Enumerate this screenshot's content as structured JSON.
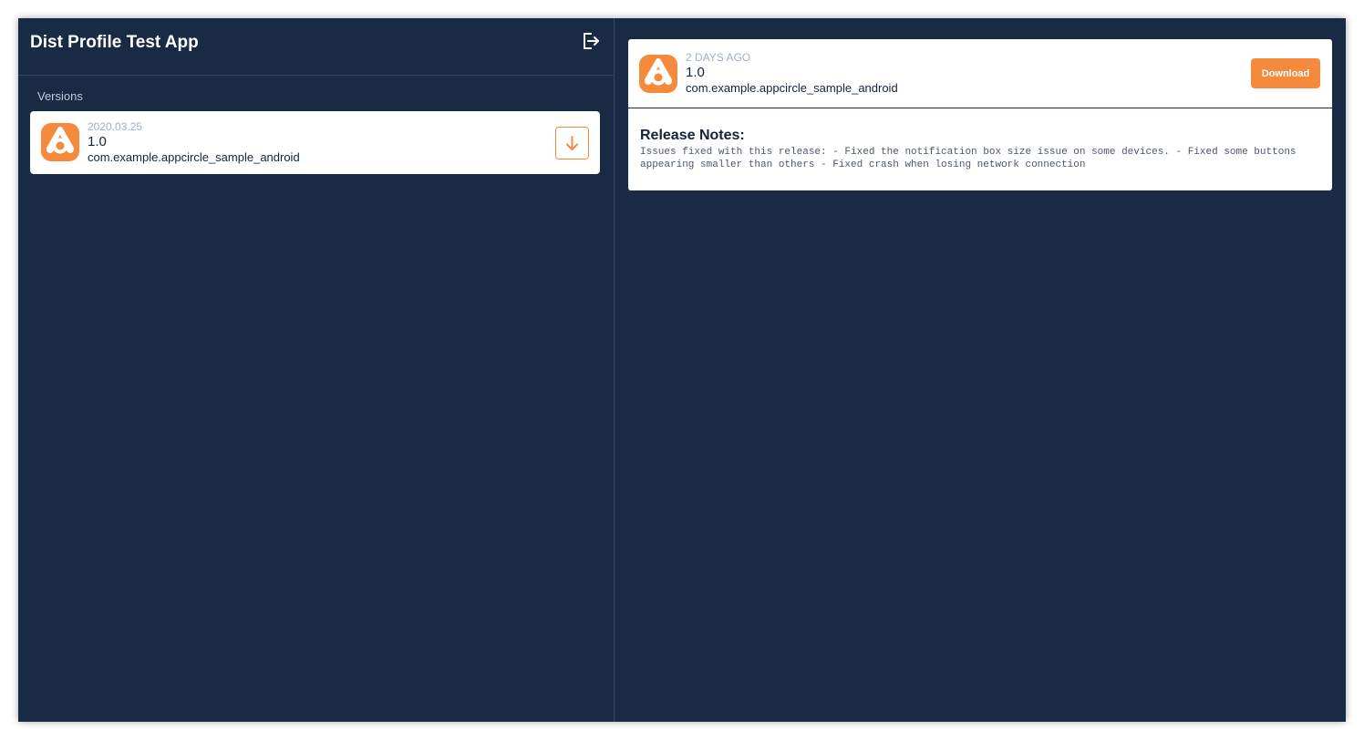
{
  "app": {
    "title": "Dist Profile Test App"
  },
  "header": {
    "logout_icon": "logout-icon"
  },
  "versions": {
    "label": "Versions",
    "items": [
      {
        "date": "2020.03.25",
        "version": "1.0",
        "package": "com.example.appcircle_sample_android",
        "icon": "appcircle-logo",
        "action_icon": "download-arrow-icon"
      }
    ]
  },
  "detail": {
    "time_ago": "2 DAYS AGO",
    "version": "1.0",
    "package": "com.example.appcircle_sample_android",
    "download_label": "Download",
    "release_notes_title": "Release Notes:",
    "release_notes": "Issues fixed with this release: - Fixed the notification box size issue on some devices. - Fixed some buttons appearing smaller than others - Fixed crash when losing network connection"
  },
  "colors": {
    "background": "#192a44",
    "accent": "#f58a3c",
    "card": "#ffffff",
    "muted_text": "#9fb1c7",
    "dark_text": "#14233a"
  }
}
